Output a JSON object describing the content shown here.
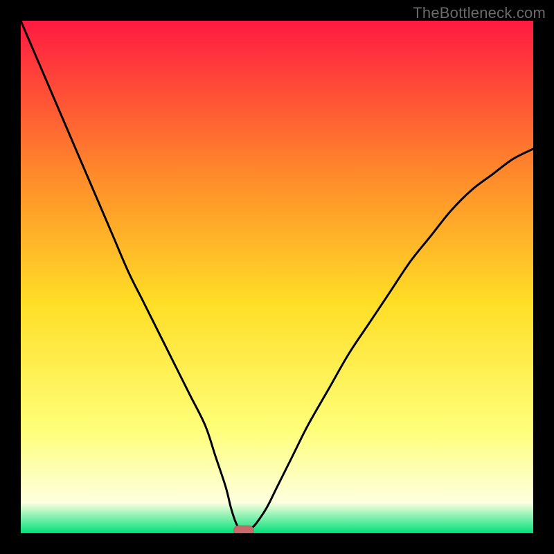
{
  "attribution": "TheBottleneck.com",
  "colors": {
    "frame": "#000000",
    "curve": "#000000",
    "marker_fill": "#c96a6a",
    "marker_stroke": "#b55a5a",
    "gradient_top": "#ff1a42",
    "gradient_q1": "#ff8a2a",
    "gradient_mid": "#ffde26",
    "gradient_q3": "#ffff7a",
    "gradient_q4": "#fdffe0",
    "gradient_bottom": "#00e07a"
  },
  "chart_data": {
    "type": "line",
    "title": "",
    "xlabel": "",
    "ylabel": "",
    "xlim": [
      0,
      100
    ],
    "ylim": [
      0,
      100
    ],
    "x": [
      0,
      3,
      6,
      9,
      12,
      15,
      18,
      21,
      24,
      27,
      30,
      33,
      36,
      38,
      40,
      41,
      42,
      43,
      44,
      45,
      46,
      48,
      50,
      53,
      56,
      60,
      64,
      68,
      72,
      76,
      80,
      84,
      88,
      92,
      96,
      100
    ],
    "values": [
      100,
      93,
      86,
      79,
      72,
      65,
      58,
      51,
      45,
      39,
      33,
      27,
      21,
      15,
      9,
      5,
      2,
      0.5,
      0.5,
      1,
      2,
      5,
      9,
      15,
      21,
      28,
      35,
      41,
      47,
      53,
      58,
      63,
      67,
      70,
      73,
      75
    ],
    "minimum_marker": {
      "x": 43.5,
      "y": 0.5
    },
    "annotations": []
  }
}
